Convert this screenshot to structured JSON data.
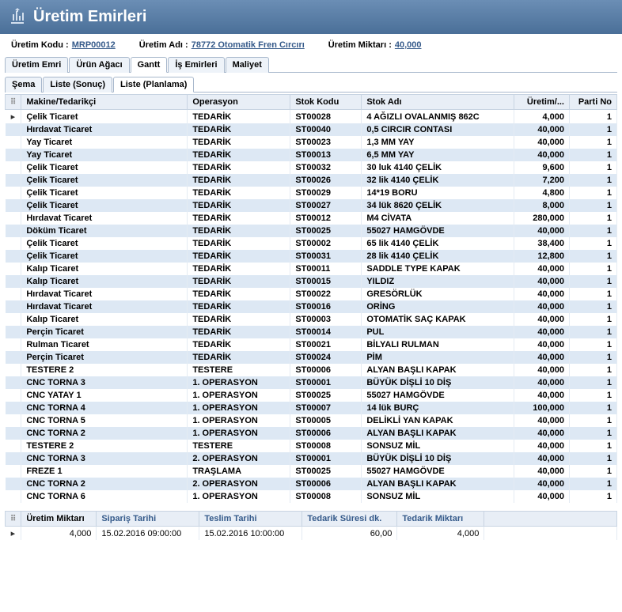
{
  "header": {
    "title": "Üretim Emirleri"
  },
  "info": {
    "uretim_kodu_label": "Üretim Kodu  :",
    "uretim_kodu": "MRP00012",
    "uretim_adi_label": "Üretim Adı  :",
    "uretim_adi": "78772 Otomatik Fren Cırcırı",
    "uretim_miktari_label": "Üretim Miktarı  :",
    "uretim_miktari": "40,000"
  },
  "tabs1": [
    "Üretim Emri",
    "Ürün Ağacı",
    "Gantt",
    "İş Emirleri",
    "Maliyet"
  ],
  "tabs1_active": 2,
  "tabs2": [
    "Şema",
    "Liste (Sonuç)",
    "Liste (Planlama)"
  ],
  "tabs2_active": 2,
  "columns": [
    "Makine/Tedarikçi",
    "Operasyon",
    "Stok Kodu",
    "Stok Adı",
    "Üretim/...",
    "Parti No"
  ],
  "rows": [
    {
      "m": "Çelik Ticaret",
      "o": "TEDARİK",
      "sk": "ST00028",
      "sa": "4 AĞIZLI OVALANMIŞ 862C",
      "u": "4,000",
      "p": "1",
      "sel": true
    },
    {
      "m": "Hırdavat Ticaret",
      "o": "TEDARİK",
      "sk": "ST00040",
      "sa": "0,5 CIRCIR CONTASI",
      "u": "40,000",
      "p": "1"
    },
    {
      "m": "Yay Ticaret",
      "o": "TEDARİK",
      "sk": "ST00023",
      "sa": "1,3 MM YAY",
      "u": "40,000",
      "p": "1"
    },
    {
      "m": "Yay Ticaret",
      "o": "TEDARİK",
      "sk": "ST00013",
      "sa": "6,5 MM YAY",
      "u": "40,000",
      "p": "1"
    },
    {
      "m": "Çelik Ticaret",
      "o": "TEDARİK",
      "sk": "ST00032",
      "sa": "30 luk 4140 ÇELİK",
      "u": "9,600",
      "p": "1"
    },
    {
      "m": "Çelik Ticaret",
      "o": "TEDARİK",
      "sk": "ST00026",
      "sa": "32 lik 4140 ÇELİK",
      "u": "7,200",
      "p": "1"
    },
    {
      "m": "Çelik Ticaret",
      "o": "TEDARİK",
      "sk": "ST00029",
      "sa": "14*19 BORU",
      "u": "4,800",
      "p": "1"
    },
    {
      "m": "Çelik Ticaret",
      "o": "TEDARİK",
      "sk": "ST00027",
      "sa": "34 lük 8620 ÇELİK",
      "u": "8,000",
      "p": "1"
    },
    {
      "m": "Hırdavat Ticaret",
      "o": "TEDARİK",
      "sk": "ST00012",
      "sa": "M4 CİVATA",
      "u": "280,000",
      "p": "1"
    },
    {
      "m": "Döküm Ticaret",
      "o": "TEDARİK",
      "sk": "ST00025",
      "sa": "55027 HAMGÖVDE",
      "u": "40,000",
      "p": "1"
    },
    {
      "m": "Çelik Ticaret",
      "o": "TEDARİK",
      "sk": "ST00002",
      "sa": "65 lik 4140 ÇELİK",
      "u": "38,400",
      "p": "1"
    },
    {
      "m": "Çelik Ticaret",
      "o": "TEDARİK",
      "sk": "ST00031",
      "sa": "28 lik 4140 ÇELİK",
      "u": "12,800",
      "p": "1"
    },
    {
      "m": "Kalıp Ticaret",
      "o": "TEDARİK",
      "sk": "ST00011",
      "sa": "SADDLE TYPE KAPAK",
      "u": "40,000",
      "p": "1"
    },
    {
      "m": "Kalıp Ticaret",
      "o": "TEDARİK",
      "sk": "ST00015",
      "sa": "YILDIZ",
      "u": "40,000",
      "p": "1"
    },
    {
      "m": "Hırdavat Ticaret",
      "o": "TEDARİK",
      "sk": "ST00022",
      "sa": "GRESÖRLÜK",
      "u": "40,000",
      "p": "1"
    },
    {
      "m": "Hırdavat Ticaret",
      "o": "TEDARİK",
      "sk": "ST00016",
      "sa": "ORİNG",
      "u": "40,000",
      "p": "1"
    },
    {
      "m": "Kalıp Ticaret",
      "o": "TEDARİK",
      "sk": "ST00003",
      "sa": "OTOMATİK SAÇ KAPAK",
      "u": "40,000",
      "p": "1"
    },
    {
      "m": "Perçin Ticaret",
      "o": "TEDARİK",
      "sk": "ST00014",
      "sa": "PUL",
      "u": "40,000",
      "p": "1"
    },
    {
      "m": "Rulman Ticaret",
      "o": "TEDARİK",
      "sk": "ST00021",
      "sa": "BİLYALI RULMAN",
      "u": "40,000",
      "p": "1"
    },
    {
      "m": "Perçin Ticaret",
      "o": "TEDARİK",
      "sk": "ST00024",
      "sa": "PİM",
      "u": "40,000",
      "p": "1"
    },
    {
      "m": "TESTERE 2",
      "o": "TESTERE",
      "sk": "ST00006",
      "sa": "ALYAN BAŞLI KAPAK",
      "u": "40,000",
      "p": "1"
    },
    {
      "m": "CNC TORNA 3",
      "o": "1. OPERASYON",
      "sk": "ST00001",
      "sa": "BÜYÜK DİŞLİ 10 DİŞ",
      "u": "40,000",
      "p": "1"
    },
    {
      "m": "CNC YATAY 1",
      "o": "1. OPERASYON",
      "sk": "ST00025",
      "sa": "55027 HAMGÖVDE",
      "u": "40,000",
      "p": "1"
    },
    {
      "m": "CNC TORNA 4",
      "o": "1. OPERASYON",
      "sk": "ST00007",
      "sa": "14 lük BURÇ",
      "u": "100,000",
      "p": "1"
    },
    {
      "m": "CNC TORNA 5",
      "o": "1. OPERASYON",
      "sk": "ST00005",
      "sa": "DELİKLİ YAN KAPAK",
      "u": "40,000",
      "p": "1"
    },
    {
      "m": "CNC TORNA 2",
      "o": "1. OPERASYON",
      "sk": "ST00006",
      "sa": "ALYAN BAŞLI KAPAK",
      "u": "40,000",
      "p": "1"
    },
    {
      "m": "TESTERE 2",
      "o": "TESTERE",
      "sk": "ST00008",
      "sa": "SONSUZ MİL",
      "u": "40,000",
      "p": "1"
    },
    {
      "m": "CNC TORNA 3",
      "o": "2. OPERASYON",
      "sk": "ST00001",
      "sa": "BÜYÜK DİŞLİ 10 DİŞ",
      "u": "40,000",
      "p": "1"
    },
    {
      "m": "FREZE 1",
      "o": "TRAŞLAMA",
      "sk": "ST00025",
      "sa": "55027 HAMGÖVDE",
      "u": "40,000",
      "p": "1"
    },
    {
      "m": "CNC TORNA 2",
      "o": "2. OPERASYON",
      "sk": "ST00006",
      "sa": "ALYAN BAŞLI KAPAK",
      "u": "40,000",
      "p": "1"
    },
    {
      "m": "CNC TORNA 6",
      "o": "1. OPERASYON",
      "sk": "ST00008",
      "sa": "SONSUZ MİL",
      "u": "40,000",
      "p": "1"
    }
  ],
  "bottom_columns": [
    "Üretim Miktarı",
    "Sipariş Tarihi",
    "Teslim Tarihi",
    "Tedarik Süresi dk.",
    "Tedarik Miktarı"
  ],
  "bottom_row": {
    "um": "4,000",
    "st": "15.02.2016 09:00:00",
    "tt": "15.02.2016 10:00:00",
    "ts": "60,00",
    "tm": "4,000"
  }
}
